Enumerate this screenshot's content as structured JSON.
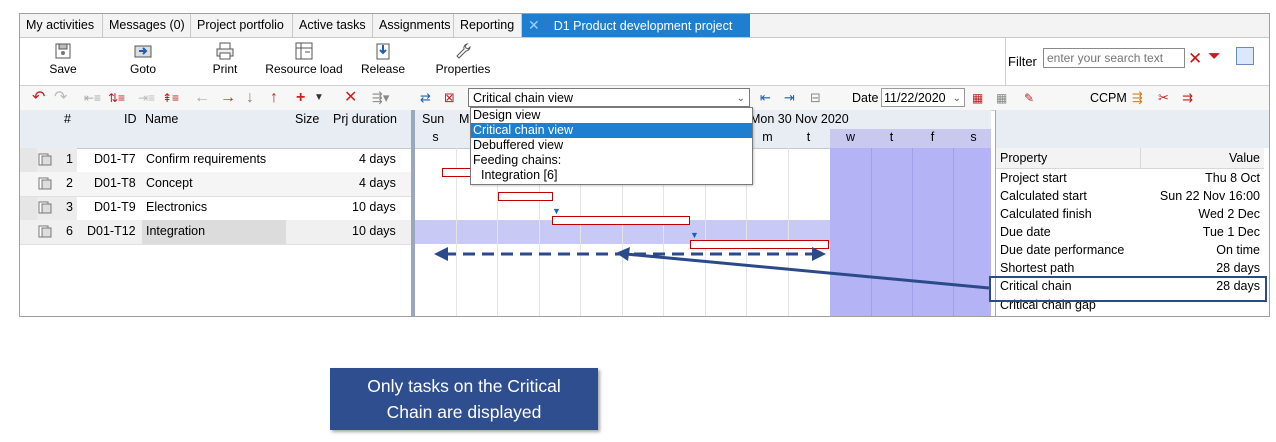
{
  "tabs": [
    {
      "label": "My activities"
    },
    {
      "label": "Messages (0)"
    },
    {
      "label": "Project portfolio"
    },
    {
      "label": "Active tasks"
    },
    {
      "label": "Assignments"
    },
    {
      "label": "Reporting"
    },
    {
      "label": "D1 Product development project"
    }
  ],
  "ribbon": {
    "save": "Save",
    "goto": "Goto",
    "print": "Print",
    "resource_load": "Resource load",
    "release": "Release",
    "properties": "Properties",
    "filter_label": "Filter",
    "filter_placeholder": "enter your search text"
  },
  "toolbar": {
    "view_selected": "Critical chain view",
    "date_label": "Date",
    "date_value": "11/22/2020",
    "ccpm_label": "CCPM"
  },
  "view_menu": {
    "items": [
      "Design view",
      "Critical chain view",
      "Debuffered view",
      "Feeding chains:",
      "Integration [6]"
    ],
    "selected": "Critical chain view"
  },
  "grid": {
    "headers": {
      "num": "#",
      "id": "ID",
      "name": "Name",
      "size": "Size",
      "duration": "Prj duration"
    },
    "rows": [
      {
        "num": "1",
        "id": "D01-T7",
        "name": "Confirm requirements",
        "duration": "4 days"
      },
      {
        "num": "2",
        "id": "D01-T8",
        "name": "Concept",
        "duration": "4 days"
      },
      {
        "num": "3",
        "id": "D01-T9",
        "name": "Electronics",
        "duration": "10 days"
      },
      {
        "num": "6",
        "id": "D01-T12",
        "name": "Integration",
        "duration": "10 days"
      }
    ]
  },
  "gantt": {
    "week1_label": "Sun",
    "week1_partial": "M",
    "week2_label": "Mon 30 Nov 2020",
    "day_letters_left": [
      "s"
    ],
    "day_letters_right": [
      "m",
      "t",
      "w",
      "t",
      "f",
      "s"
    ],
    "bars": [
      {
        "task": "Confirm requirements",
        "start_day": 0.3,
        "end_day": 2.0
      },
      {
        "task": "Concept",
        "start_day": 2.0,
        "end_day": 3.4
      },
      {
        "task": "Electronics",
        "start_day": 3.4,
        "end_day": 6.7
      },
      {
        "task": "Integration",
        "start_day": 6.7,
        "end_day": 10.0
      }
    ]
  },
  "properties": {
    "header_key": "Property",
    "header_value": "Value",
    "rows": [
      {
        "key": "Project start",
        "value": "Thu 8 Oct"
      },
      {
        "key": "Calculated start",
        "value": "Sun 22 Nov 16:00"
      },
      {
        "key": "Calculated finish",
        "value": "Wed 2 Dec"
      },
      {
        "key": "Due date",
        "value": "Tue 1 Dec"
      },
      {
        "key": "Due date performance",
        "value": "On time"
      },
      {
        "key": "Shortest path",
        "value": "28 days"
      },
      {
        "key": "Critical chain",
        "value": "28 days"
      },
      {
        "key": "Critical chain gap",
        "value": ""
      }
    ]
  },
  "callout": {
    "line1": "Only tasks on the Critical",
    "line2": "Chain are displayed"
  },
  "colors": {
    "tab_active": "#1e7fd0",
    "callout_bg": "#2f4e8f",
    "bar_border": "#c00000",
    "weekend_shade": "#b3b3f5"
  }
}
